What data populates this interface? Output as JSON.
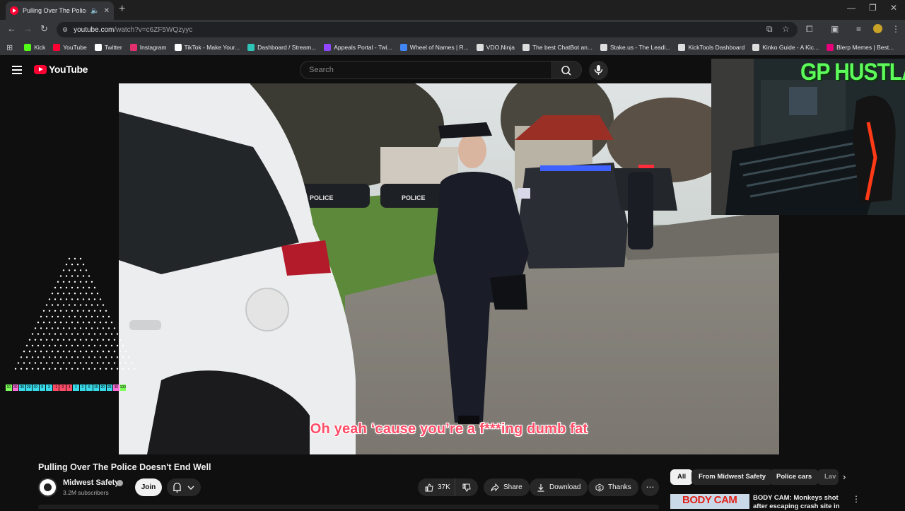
{
  "browser": {
    "tab_title": "Pulling Over The Police Doe",
    "url_host": "youtube.com",
    "url_path": "/watch?v=c6ZF5WQzyyc",
    "bookmarks": [
      {
        "label": "Kick",
        "color": "#53fc18"
      },
      {
        "label": "YouTube",
        "color": "#ff0033"
      },
      {
        "label": "Twitter",
        "color": "#ffffff"
      },
      {
        "label": "Instagram",
        "color": "#e1306c"
      },
      {
        "label": "TikTok - Make Your...",
        "color": "#ffffff"
      },
      {
        "label": "Dashboard / Stream...",
        "color": "#2ec4b6"
      },
      {
        "label": "Appeals Portal - Twi...",
        "color": "#9146ff"
      },
      {
        "label": "Wheel of Names | R...",
        "color": "#4285f4"
      },
      {
        "label": "VDO.Ninja",
        "color": "#dddddd"
      },
      {
        "label": "The best ChatBot an...",
        "color": "#dddddd"
      },
      {
        "label": "Stake.us - The Leadi...",
        "color": "#dddddd"
      },
      {
        "label": "KickTools Dashboard",
        "color": "#dddddd"
      },
      {
        "label": "Kinko Guide - A Kic...",
        "color": "#dddddd"
      },
      {
        "label": "Blerp Memes | Best...",
        "color": "#e6007a"
      }
    ]
  },
  "youtube": {
    "logo_text": "YouTube",
    "search_placeholder": "Search"
  },
  "video": {
    "subtitle": "Oh yeah ‘cause you’re a f***ing dumb fat",
    "title": "Pulling Over The Police Doesn't End Well",
    "channel": "Midwest Safety",
    "subscribers": "3.2M subscribers",
    "join_label": "Join",
    "like_count": "37K",
    "share_label": "Share",
    "download_label": "Download",
    "thanks_label": "Thanks"
  },
  "overlay": {
    "webcam_text": "GP HUSTLA",
    "bar_values": [
      "10",
      "30",
      "35",
      "20",
      "10",
      "8",
      "3",
      "-1",
      "-2",
      "-1",
      "1",
      "3",
      "5",
      "10",
      "20",
      "25",
      "30",
      "100"
    ],
    "bar_colors": [
      "#7dff5a",
      "#ff6fd8",
      "#38d9e8",
      "#38d9e8",
      "#38d9e8",
      "#38d9e8",
      "#38d9e8",
      "#ff4d67",
      "#ff4d67",
      "#ff4d67",
      "#38d9e8",
      "#38d9e8",
      "#38d9e8",
      "#38d9e8",
      "#38d9e8",
      "#38d9e8",
      "#ff6fd8",
      "#7dff5a"
    ]
  },
  "sidebar": {
    "chips": [
      "All",
      "From Midwest Safety",
      "Police cars",
      "Lav"
    ],
    "rec_thumb_text": "BODY CAM",
    "rec_title": "BODY CAM: Monkeys shot after escaping crash site in"
  }
}
